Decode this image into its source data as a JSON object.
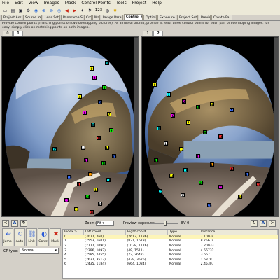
{
  "menu": [
    "File",
    "Edit",
    "View",
    "Images",
    "Mask",
    "Control Points",
    "Tools",
    "Project",
    "Help"
  ],
  "toolbar": {
    "icons": [
      "new-icon",
      "open-icon",
      "save-icon",
      "optimize-icon",
      "stitch-icon",
      "zoom-in-icon",
      "zoom-out-icon",
      "zoom-fit-icon",
      "go-left-icon",
      "go-right-icon",
      "fine-tune-icon",
      "flag-icon",
      "preview-icon",
      "bulb-icon"
    ],
    "number_label": "123"
  },
  "tabs": [
    "Project Assistant",
    "Source Images",
    "Lens Settings",
    "Panorama Settings",
    "Crop",
    "Mask",
    "Image Parameters",
    "Control Points",
    "Optimizer",
    "Exposure HDR",
    "Project Settings",
    "Preview",
    "Create Pa"
  ],
  "active_tab": "Control Points",
  "instructions": "Provide control points (matching points on two overlapping pictures). As a rule of thumb, provide at least three control points for each pair of overlapping images. It's easy: simply click on matching points on both images.",
  "left_image_tabs": [
    "0",
    "1"
  ],
  "left_active": "1",
  "right_image_tabs": [
    "1",
    "2"
  ],
  "right_active": "2",
  "controls": {
    "zoom_label": "Zoom:",
    "zoom_value": "Fit",
    "preview_exposure_label": "Preview exposure:",
    "ev_value": "EV 0",
    "ev_position": 0.55,
    "left_nav_prev": "<",
    "left_nav_a": "A",
    "right_nav_a": "A",
    "right_nav_next": ">"
  },
  "actions": [
    {
      "label": "Jump",
      "icon": "jump-icon"
    },
    {
      "label": "Auto",
      "icon": "auto-icon"
    },
    {
      "label": "Link",
      "icon": "link-icon"
    },
    {
      "label": "Contr.",
      "icon": "contrast-icon"
    },
    {
      "label": "Mask",
      "icon": "delete-icon"
    }
  ],
  "cp_type_label": "CP type:",
  "cp_type_value": "Normal",
  "table": {
    "headers": [
      "Index >",
      "Left coord",
      "Right coord",
      "Type",
      "Distance"
    ],
    "rows": [
      [
        "0",
        "(3077, 760)",
        "(2613, 1186)",
        "Normal",
        "7.10034"
      ],
      [
        "1",
        "(2553, 1601)",
        "(821, 1673)",
        "Normal",
        "8.75674"
      ],
      [
        "2",
        "(2777, 1090)",
        "(1038, 1176)",
        "Normal",
        "7.20933"
      ],
      [
        "3",
        "(2396, 1092)",
        "(49, 1511)",
        "Normal",
        "4.56732"
      ],
      [
        "4",
        "(2585, 2455)",
        "(72, 2642)",
        "Normal",
        "3.667"
      ],
      [
        "5",
        "(2637, 3513)",
        "(439, 3526)",
        "Normal",
        "1.5878"
      ],
      [
        "6",
        "(2435, 1184)",
        "(664, 1084)",
        "Normal",
        "2.45307"
      ]
    ],
    "selected_row": 0
  },
  "colors": {
    "cp_palette": [
      "#ffff00",
      "#00ffff",
      "#ff00ff",
      "#00ff00",
      "#3a70ff",
      "#ff3030",
      "#ffffff",
      "#ff9900"
    ]
  }
}
